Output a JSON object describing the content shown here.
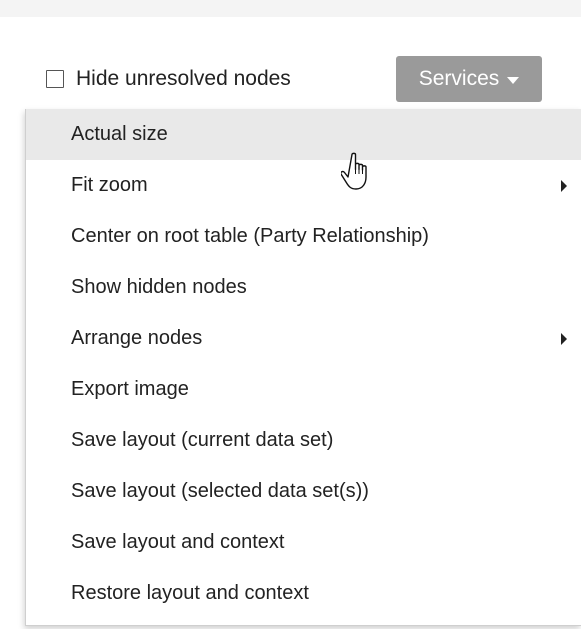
{
  "toolbar": {
    "checkbox_label": "Hide unresolved nodes",
    "checkbox_checked": false,
    "services_label": "Services"
  },
  "menu": {
    "items": [
      {
        "label": "Actual size",
        "has_submenu": false,
        "highlighted": true
      },
      {
        "label": "Fit zoom",
        "has_submenu": true,
        "highlighted": false
      },
      {
        "label": "Center on root table (Party Relationship)",
        "has_submenu": false,
        "highlighted": false
      },
      {
        "label": "Show hidden nodes",
        "has_submenu": false,
        "highlighted": false
      },
      {
        "label": "Arrange nodes",
        "has_submenu": true,
        "highlighted": false
      },
      {
        "label": "Export image",
        "has_submenu": false,
        "highlighted": false
      },
      {
        "label": "Save layout (current data set)",
        "has_submenu": false,
        "highlighted": false
      },
      {
        "label": "Save layout (selected data set(s))",
        "has_submenu": false,
        "highlighted": false
      },
      {
        "label": "Save layout and context",
        "has_submenu": false,
        "highlighted": false
      },
      {
        "label": "Restore layout and context",
        "has_submenu": false,
        "highlighted": false
      }
    ]
  },
  "colors": {
    "services_button_bg": "#9a9a9a",
    "highlight_bg": "#e9e9e9",
    "text": "#222222"
  },
  "icons": {
    "cursor": "hand-pointer-icon",
    "submenu": "caret-right-icon",
    "dropdown": "caret-down-icon"
  }
}
